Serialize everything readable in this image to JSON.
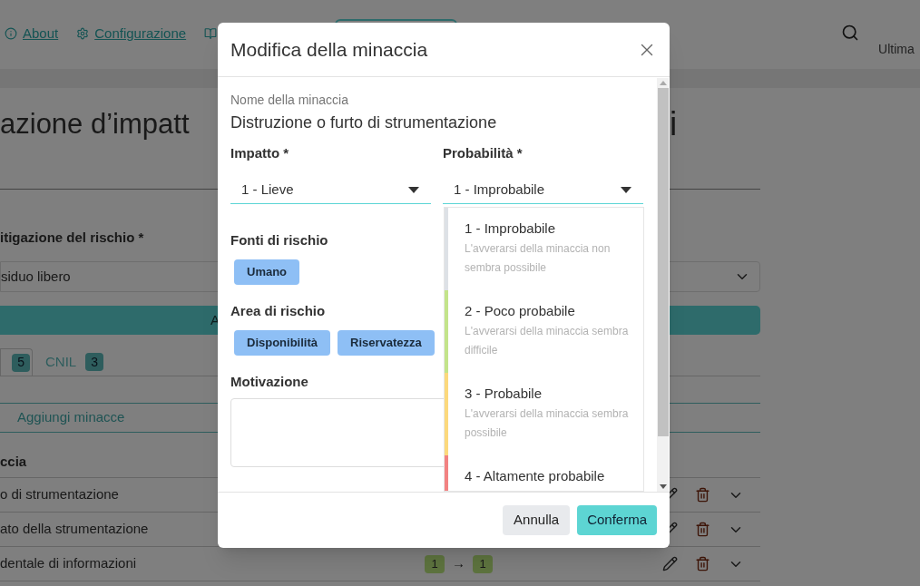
{
  "nav": {
    "links": [
      {
        "label": "About",
        "kind": "info"
      },
      {
        "label": "Configurazione",
        "kind": "settings"
      }
    ],
    "user": "Ultima"
  },
  "page": {
    "title_start": "azione d’impatt",
    "title_end": "i",
    "mitigation": {
      "label": "itigazione del rischio *",
      "value": "siduo libero"
    },
    "action_button": "A",
    "tabs": [
      {
        "badge": "5",
        "selected": true
      },
      {
        "label": "CNIL",
        "badge": "3",
        "selected": false
      }
    ],
    "add_threats": "Aggiungi minacce",
    "table": {
      "column": "ccia",
      "rows": [
        {
          "name": "o di strumentazione"
        },
        {
          "name": "ato della strumentazione"
        },
        {
          "name": "dentale di informazioni",
          "from": "1",
          "arrow": "→",
          "to": "1"
        }
      ]
    }
  },
  "modal": {
    "title": "Modifica della minaccia",
    "name_label": "Nome della minaccia",
    "name_value": "Distruzione o furto di strumentazione",
    "impact": {
      "label": "Impatto *",
      "value": "1 - Lieve"
    },
    "probability": {
      "label": "Probabilità *",
      "value": "1 - Improbabile",
      "expanded": true,
      "options": [
        {
          "title": "1 - Improbabile",
          "description": "L'avverarsi della minaccia non sembra possibile",
          "color": "#dde1e6"
        },
        {
          "title": "2 - Poco probabile",
          "description": "L'avverarsi della minaccia sembra difficile",
          "color": "#c3e48a"
        },
        {
          "title": "3 - Probabile",
          "description": "L'avverarsi della minaccia sembra possibile",
          "color": "#fcd97c"
        },
        {
          "title": "4 - Altamente probabile",
          "color": "#f28282"
        }
      ]
    },
    "sources": {
      "label": "Fonti di rischio",
      "tags": [
        "Umano"
      ]
    },
    "areas": {
      "label": "Area di rischio",
      "tags": [
        "Disponibilità",
        "Riservatezza"
      ]
    },
    "motivation": {
      "label": "Motivazione"
    },
    "cancel": "Annulla",
    "confirm": "Conferma"
  }
}
